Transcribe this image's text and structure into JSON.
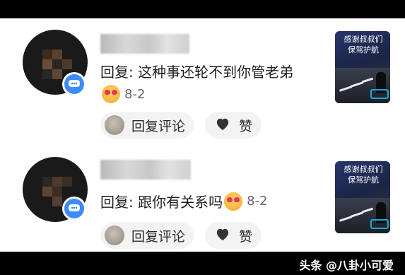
{
  "comments": [
    {
      "name_visible": "",
      "reply_text": "回复: 这种事还轮不到你管老弟",
      "date": "8-2",
      "reply_button_label": "回复评论",
      "like_label": "赞",
      "thumbnail_text": "感谢叔叔们\n保驾护航"
    },
    {
      "name_visible": "",
      "reply_text": "回复: 跟你有关系吗",
      "date": "8-2",
      "reply_button_label": "回复评论",
      "like_label": "赞",
      "thumbnail_text": "感谢叔叔们\n保驾护航"
    }
  ],
  "watermark": "头条 @八卦小可爱",
  "icons": {
    "badge": "chat-bubble-icon",
    "like": "heart-icon",
    "emoji": "heart-eyes-emoji-icon"
  },
  "colors": {
    "badge_blue": "#3d8bff",
    "pill_bg": "#f3f3f3",
    "text": "#1f1f1f",
    "meta": "#666666"
  }
}
